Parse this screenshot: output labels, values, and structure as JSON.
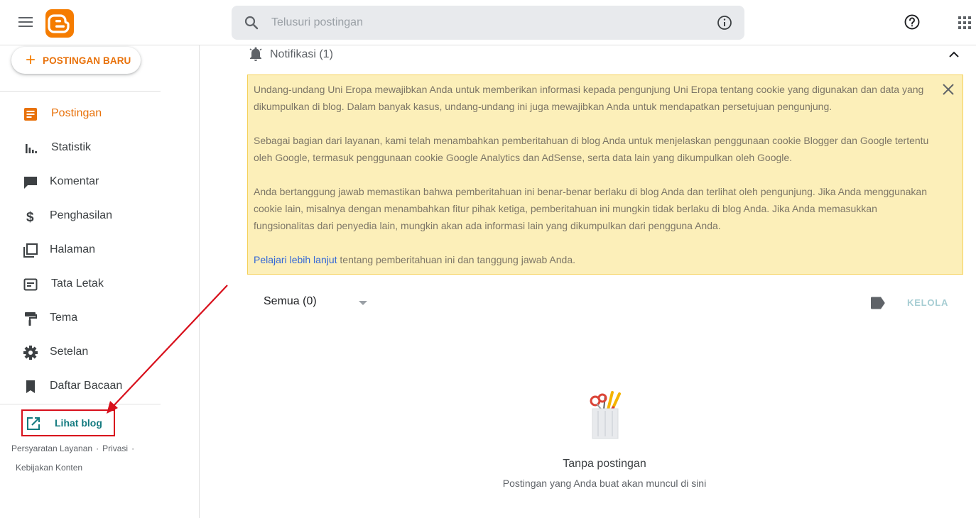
{
  "header": {
    "search_placeholder": "Telusuri postingan",
    "icons": [
      "menu-icon",
      "blogger-logo",
      "search-icon",
      "info-icon",
      "help-icon",
      "apps-icon"
    ],
    "brand_color": "#f57c00"
  },
  "sidebar": {
    "new_post_label": "POSTINGAN BARU",
    "items": [
      {
        "label": "Postingan",
        "icon": "posts-icon",
        "active": true
      },
      {
        "label": "Statistik",
        "icon": "stats-icon"
      },
      {
        "label": "Komentar",
        "icon": "comment-icon"
      },
      {
        "label": "Penghasilan",
        "icon": "dollar-icon"
      },
      {
        "label": "Halaman",
        "icon": "pages-icon"
      },
      {
        "label": "Tata Letak",
        "icon": "layout-icon"
      },
      {
        "label": "Tema",
        "icon": "theme-icon"
      },
      {
        "label": "Setelan",
        "icon": "gear-icon"
      },
      {
        "label": "Daftar Bacaan",
        "icon": "bookmark-icon"
      }
    ],
    "view_blog_label": "Lihat blog",
    "footer": {
      "terms": "Persyaratan Layanan",
      "privacy": "Privasi",
      "content_policy": "Kebijakan Konten",
      "separator": "·"
    }
  },
  "notification": {
    "title": "Notifikasi (1)",
    "paragraph1": "Undang-undang Uni Eropa mewajibkan Anda untuk memberikan informasi kepada pengunjung Uni Eropa tentang cookie yang digunakan dan data yang dikumpulkan di blog. Dalam banyak kasus, undang-undang ini juga mewajibkan Anda untuk mendapatkan persetujuan pengunjung.",
    "paragraph2": "Sebagai bagian dari layanan, kami telah menambahkan pemberitahuan di blog Anda untuk menjelaskan penggunaan cookie Blogger dan Google tertentu oleh Google, termasuk penggunaan cookie Google Analytics dan AdSense, serta data lain yang dikumpulkan oleh Google.",
    "paragraph3": "Anda bertanggung jawab memastikan bahwa pemberitahuan ini benar-benar berlaku di blog Anda dan terlihat oleh pengunjung. Jika Anda menggunakan cookie lain, misalnya dengan menambahkan fitur pihak ketiga, pemberitahuan ini mungkin tidak berlaku di blog Anda. Jika Anda memasukkan fungsionalitas dari penyedia lain, mungkin akan ada informasi lain yang dikumpulkan dari pengguna Anda.",
    "learn_more_link": "Pelajari lebih lanjut",
    "learn_more_rest": " tentang pemberitahuan ini dan tanggung jawab Anda.",
    "banner_color": "#fcefb9"
  },
  "posts": {
    "filter_label": "Semua (0)",
    "manage_label": "KELOLA",
    "empty_title": "Tanpa postingan",
    "empty_subtitle": "Postingan yang Anda buat akan muncul di sini"
  },
  "annotation": {
    "highlight_color": "#d8101c"
  }
}
